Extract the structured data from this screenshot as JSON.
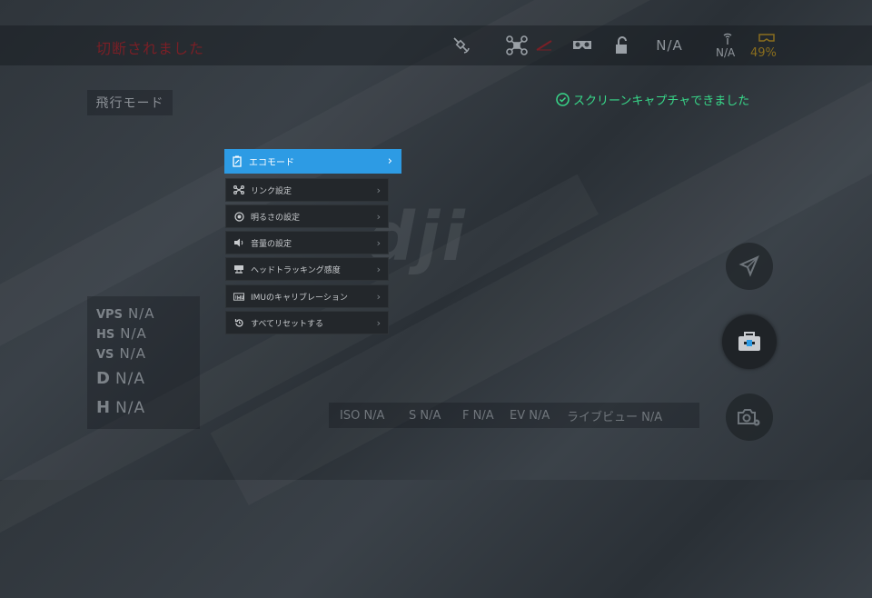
{
  "status": {
    "title": "切断されました",
    "altitude_na": "N/A",
    "rc_signal_na": "N/A",
    "battery_percent": "49%"
  },
  "flight_mode": "飛行モード",
  "toast": "スクリーンキャプチャできました",
  "menu": {
    "items": [
      {
        "label": "エコモード",
        "icon": "eco-mode-icon"
      },
      {
        "label": "リンク設定",
        "icon": "link-settings-icon"
      },
      {
        "label": "明るさの設定",
        "icon": "brightness-icon"
      },
      {
        "label": "音量の設定",
        "icon": "volume-icon"
      },
      {
        "label": "ヘッドトラッキング感度",
        "icon": "head-tracking-icon"
      },
      {
        "label": "IMUのキャリブレーション",
        "icon": "imu-icon"
      },
      {
        "label": "すべてリセットする",
        "icon": "reset-icon"
      }
    ]
  },
  "watermark": "dji",
  "telemetry": {
    "vps": {
      "label": "VPS",
      "value": "N/A"
    },
    "hs": {
      "label": "HS",
      "value": "N/A"
    },
    "vs": {
      "label": "VS",
      "value": "N/A"
    },
    "d": {
      "label": "D",
      "value": "N/A"
    },
    "h": {
      "label": "H",
      "value": "N/A"
    }
  },
  "camera": {
    "iso": "ISO N/A",
    "shutter": "S N/A",
    "fnum": "F N/A",
    "ev": "EV N/A",
    "liveview": "ライブビュー N/A"
  },
  "colors": {
    "accent": "#2d9be4",
    "toast": "#38d98a",
    "warning": "#7a1f26",
    "battery": "#8a6e1e"
  }
}
